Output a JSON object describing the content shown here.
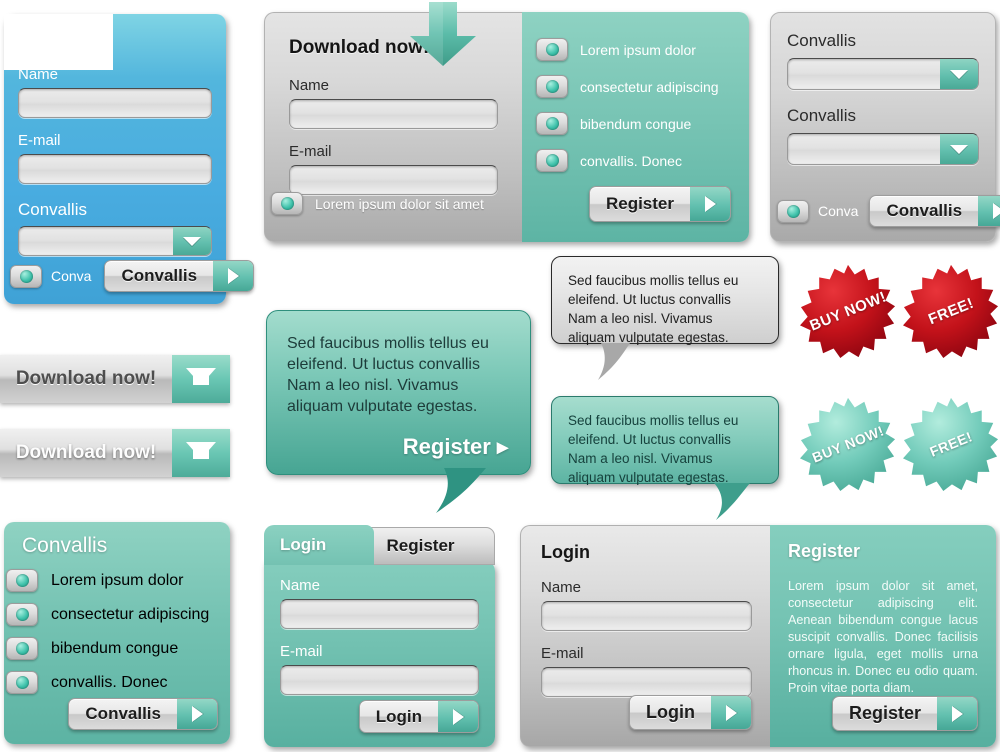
{
  "colors": {
    "teal": "#6fbfb0",
    "teal_dark": "#47a593",
    "blue": "#4aaed8",
    "grey": "#c8c8c8",
    "red": "#c8161d",
    "white": "#ffffff"
  },
  "blue_form": {
    "name_label": "Name",
    "name_value": "",
    "name_placeholder": "",
    "email_label": "E-mail",
    "email_value": "",
    "email_placeholder": "",
    "select_label": "Convallis",
    "select_value": "",
    "radio_label": "Conva",
    "button_label": "Convallis"
  },
  "download_buttons": [
    {
      "label": "Download now!",
      "style": "dark-text"
    },
    {
      "label": "Download now!",
      "style": "white-text"
    }
  ],
  "combo_panel": {
    "heading": "Download now!",
    "name_label": "Name",
    "name_value": "",
    "email_label": "E-mail",
    "email_value": "",
    "checkbox_label": "Lorem ipsum dolor sit amet",
    "features": [
      "Lorem  ipsum  dolor",
      "consectetur adipiscing",
      "bibendum  congue",
      "convallis.  Donec"
    ],
    "register_label": "Register"
  },
  "selects_panel": {
    "label_1": "Convallis",
    "value_1": "",
    "label_2": "Convallis",
    "value_2": "",
    "radio_label": "Conva",
    "button_label": "Convallis"
  },
  "bubble_big": {
    "body": "Sed faucibus mollis tellus eu eleifend. Ut luctus convallis Nam a leo nisl. Vivamus aliquam vulputate egestas.",
    "cta_label": "Register"
  },
  "bubble_grey": {
    "body": "Sed faucibus mollis tellus eu eleifend. Ut luctus convallis Nam a leo nisl. Vivamus aliquam vulputate egestas."
  },
  "bubble_teal": {
    "body": "Sed faucibus mollis tellus eu eleifend. Ut luctus convallis Nam a leo nisl. Vivamus aliquam vulputate egestas."
  },
  "badges": [
    {
      "label": "BUY NOW!",
      "color": "red"
    },
    {
      "label": "FREE!",
      "color": "red"
    },
    {
      "label": "BUY NOW!",
      "color": "teal"
    },
    {
      "label": "FREE!",
      "color": "teal"
    }
  ],
  "list_panel": {
    "title": "Convallis",
    "items": [
      "Lorem  ipsum  dolor",
      "consectetur adipiscing",
      "bibendum  congue",
      "convallis.  Donec"
    ],
    "button_label": "Convallis"
  },
  "tabs_panel": {
    "tab_login": "Login",
    "tab_register": "Register",
    "name_label": "Name",
    "name_value": "",
    "email_label": "E-mail",
    "email_value": "",
    "button_label": "Login"
  },
  "split_panel": {
    "login_title": "Login",
    "name_label": "Name",
    "name_value": "",
    "email_label": "E-mail",
    "email_value": "",
    "login_button": "Login",
    "register_title": "Register",
    "register_body": "Lorem ipsum dolor sit amet, consectetur adipiscing elit. Aenean bibendum congue lacus suscipit convallis. Donec facilisis ornare ligula, eget mollis urna rhoncus in. Donec eu odio quam. Proin vitae porta diam.",
    "register_button": "Register"
  }
}
